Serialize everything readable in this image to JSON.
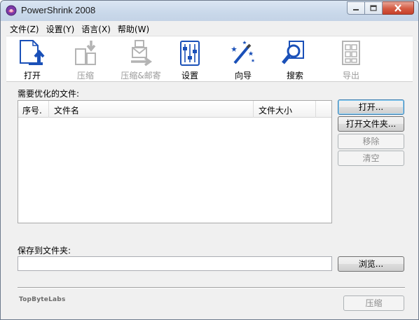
{
  "window": {
    "title": "PowerShrink 2008"
  },
  "menu": [
    {
      "label": "文件(Z)"
    },
    {
      "label": "设置(Y)"
    },
    {
      "label": "语言(X)"
    },
    {
      "label": "帮助(W)"
    }
  ],
  "toolbar": {
    "open": {
      "label": "打开",
      "icon": "open-file-icon",
      "enabled": true
    },
    "compress": {
      "label": "压缩",
      "icon": "compress-icon",
      "enabled": false
    },
    "compress_mail": {
      "label": "压缩&邮寄",
      "icon": "compress-mail-icon",
      "enabled": false
    },
    "settings": {
      "label": "设置",
      "icon": "sliders-icon",
      "enabled": true
    },
    "wizard": {
      "label": "向导",
      "icon": "magic-wand-icon",
      "enabled": true
    },
    "search": {
      "label": "搜索",
      "icon": "magnifier-icon",
      "enabled": true
    },
    "export": {
      "label": "导出",
      "icon": "export-icon",
      "enabled": false
    }
  },
  "files_section": {
    "label": "需要优化的文件:",
    "columns": [
      "序号.",
      "文件名",
      "文件大小"
    ],
    "rows": []
  },
  "buttons": {
    "open": {
      "label": "打开...",
      "enabled": true
    },
    "open_folder": {
      "label": "打开文件夹...",
      "enabled": true
    },
    "remove": {
      "label": "移除",
      "enabled": false
    },
    "clear": {
      "label": "清空",
      "enabled": false
    },
    "browse": {
      "label": "浏览...",
      "enabled": true
    },
    "compress": {
      "label": "压缩",
      "enabled": false
    }
  },
  "save_section": {
    "label": "保存到文件夹:",
    "value": ""
  },
  "brand": "TopByteLabs",
  "colors": {
    "accent_blue": "#1a50b8",
    "disabled_gray": "#b4b4b4",
    "close_red": "#c7412a"
  }
}
